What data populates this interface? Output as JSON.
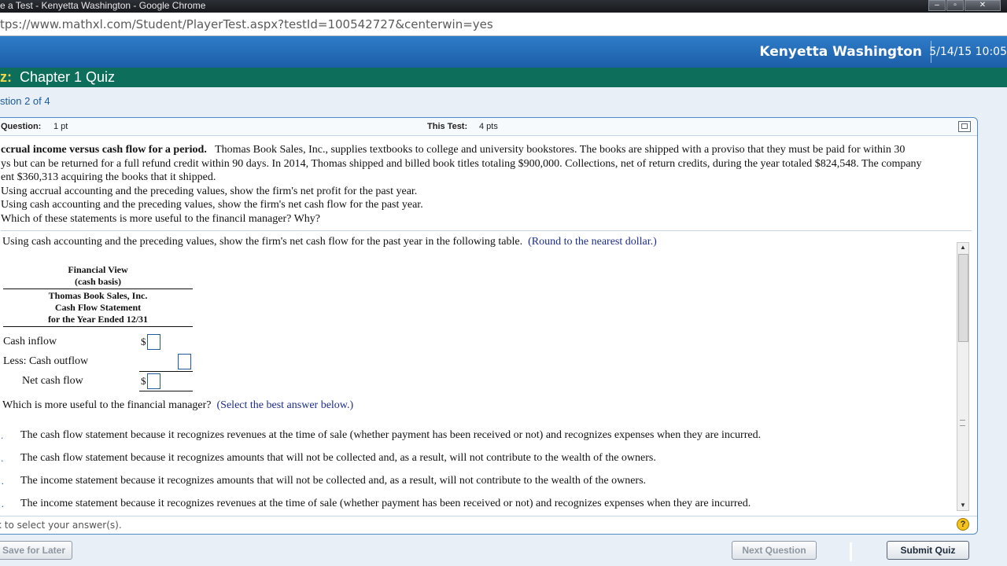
{
  "window": {
    "title": "e a Test - Kenyetta Washington - Google Chrome",
    "url": "tps://www.mathxl.com/Student/PlayerTest.aspx?testId=100542727&centerwin=yes"
  },
  "header": {
    "user_name": "Kenyetta Washington",
    "datetime": "5/14/15 10:05"
  },
  "quiz": {
    "prefix": "z:",
    "name": "Chapter 1 Quiz",
    "question_count": "stion 2 of 4"
  },
  "panel": {
    "question_label": "Question:",
    "question_points": "1 pt",
    "test_label": "This Test:",
    "test_points": "4 pts"
  },
  "problem": {
    "title": "ccrual income versus cash flow for a period.",
    "line1": "Thomas Book Sales, Inc., supplies textbooks to college and university bookstores.  The books are shipped with a proviso that they must be paid for within 30",
    "line2": "ys but can be returned for a full refund credit within 90 days.  In 2014, Thomas shipped and billed book titles totaling $900,000.  Collections, net of return credits, during the year totaled $824,548.  The company",
    "line3": "ent $360,313 acquiring the books that it shipped.",
    "part_a": " Using accrual accounting and the preceding values, show the firm's net profit for the past year.",
    "part_b": "Using cash accounting and the preceding values, show the firm's net cash flow for the past year.",
    "part_c": "Which of these statements is more useful to the financil manager? Why?"
  },
  "answer": {
    "instruction": "Using cash accounting and the preceding values, show the firm's net cash flow for the past year in the following table.",
    "round_note": "(Round to the nearest dollar.)",
    "table": {
      "header_1": "Financial View",
      "header_2": "(cash basis)",
      "sub_1": "Thomas Book Sales, Inc.",
      "sub_2": "Cash Flow Statement",
      "sub_3": "for the Year Ended 12/31",
      "rows": [
        {
          "label": "Cash inflow",
          "currency": "$",
          "value": ""
        },
        {
          "label": "Less: Cash outflow",
          "currency": "",
          "value": ""
        },
        {
          "label": "Net cash flow",
          "currency": "$",
          "value": ""
        }
      ]
    },
    "question": "Which is more useful to the financial manager?",
    "select_note": "(Select the best answer below.)",
    "options": [
      {
        "letter": "A.",
        "text": "The cash flow statement because it recognizes revenues at the time of sale (whether payment has been received or not) and recognizes expenses when they are incurred."
      },
      {
        "letter": "B.",
        "text": "The cash flow statement because it recognizes amounts that will not be collected and, as a result, will not contribute to the wealth of the owners."
      },
      {
        "letter": "C.",
        "text": "The income statement because it recognizes amounts that will not be collected and, as a result, will not contribute to the wealth of the owners."
      },
      {
        "letter": "D.",
        "text": "The income statement because it recognizes revenues at the time of sale (whether payment has been received or not) and recognizes expenses when they are incurred."
      }
    ]
  },
  "footer": {
    "hint": "k to select your answer(s).",
    "save_label": "Save for Later",
    "next_label": "Next Question",
    "submit_label": "Submit Quiz"
  },
  "icons": {
    "help": "question-mark-icon",
    "expand": "expand-window-icon"
  },
  "colors": {
    "header_blue": "#1f64b0",
    "quiz_green": "#0d6e5c",
    "prefix_yellow": "#f2d94a",
    "link_blue": "#1a2d8a"
  }
}
